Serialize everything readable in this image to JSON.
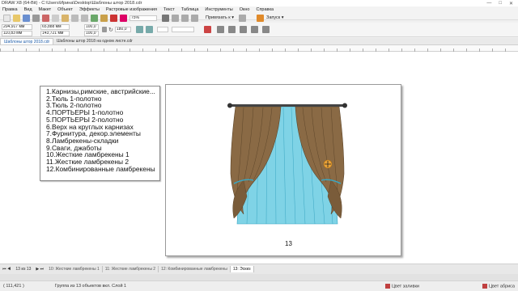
{
  "window": {
    "title": "DRAW X8 (64-Bit) - C:\\Users\\Ирина\\Desktop\\Шаблоны штор 2018.cdr",
    "controls": [
      "—",
      "□",
      "✕"
    ]
  },
  "menu": {
    "items": [
      "Правка",
      "Вид",
      "Макет",
      "Объект",
      "Эффекты",
      "Растровые изображения",
      "Текст",
      "Таблица",
      "Инструменты",
      "Окно",
      "Справка"
    ]
  },
  "toolbar": {
    "zoom": "75%",
    "snap_label": "Привязать к",
    "launch_label": "Запуск"
  },
  "properties": {
    "x": "204,917 мм",
    "y": "110,83 мм",
    "w": "65,888 мм",
    "h": "143,721 мм",
    "scale_x": "100,0",
    "scale_y": "100,0",
    "rotation": "180,0"
  },
  "doc_tabs": [
    "Шаблоны штор 2018.cdr",
    "Шаблоны штор 2018 на одном листе.cdr"
  ],
  "list_items": [
    "1.Карнизы,римские, австрийские...",
    "2.Тюль 1-полотно",
    "3.Тюль 2-полотно",
    "4.ПОРТЬЕРЫ 1-полотно",
    "5.ПОРТЬЕРЫ 2-полотно",
    "6.Верх на круглых карнизах",
    "7.Фурнитура, декор.элементы",
    "8.Ламбрекены-складки",
    "9.Сваги, джаботы",
    "10.Жесткие ламбрекены 1",
    "11.Жесткие ламбрекены 2",
    "12.Комбинированные ламбрекены"
  ],
  "page_number": "13",
  "page_nav": {
    "current": "13",
    "of_label": "из",
    "total": "13",
    "tabs": [
      "10: Жесткие ламбрекены 1",
      "11: Жесткие ламбрекены 2",
      "12: Комбинированные ламбрекены",
      "13: Эскиз"
    ]
  },
  "status": {
    "coords": "( 111,421 )",
    "selection": "Группа из 13 объектов вкл. Слой 1",
    "fill_label": "Цвет заливки",
    "outline_label": "Цвет абриса"
  },
  "colors": {
    "curtain_brown": "#8a6a45",
    "curtain_brown_dark": "#5e462a",
    "tulle_blue": "#7fd3e6",
    "tulle_blue_dark": "#3aa6c2"
  }
}
